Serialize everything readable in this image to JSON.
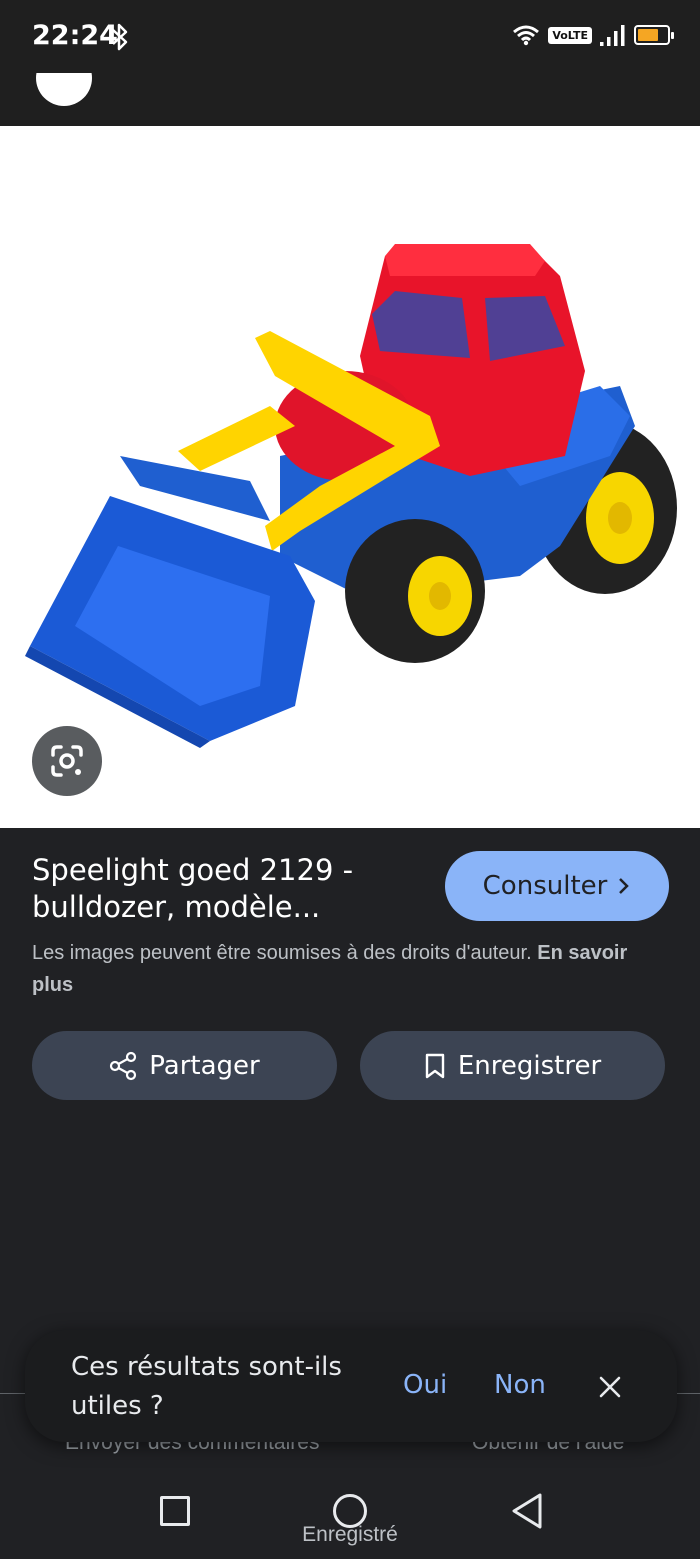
{
  "status_bar": {
    "time": "22:24",
    "volte": "VoLTE",
    "battery_level": 0.7,
    "battery_color": "#f5a623"
  },
  "image": {
    "subject_icon": "toy-loader-tractor-image",
    "lens_icon": "google-lens-icon"
  },
  "result": {
    "title": "Speelight goed 2129 - bulldozer, modèle...",
    "consult_label": "Consulter",
    "copyright_text": "Les images peuvent être soumises à des droits d'auteur.",
    "learn_more": "En savoir plus"
  },
  "actions": {
    "share_label": "Partager",
    "save_label": "Enregistrer"
  },
  "footer": {
    "send_feedback": "Envoyer des commentaires",
    "get_help": "Obtenir de l'aide"
  },
  "feedback": {
    "question": "Ces résultats sont-ils utiles ?",
    "yes": "Oui",
    "no": "Non"
  },
  "toast": {
    "saved": "Enregistré"
  },
  "colors": {
    "accent": "#8ab4f8",
    "background": "#202124",
    "button_bg": "#3c4453"
  }
}
